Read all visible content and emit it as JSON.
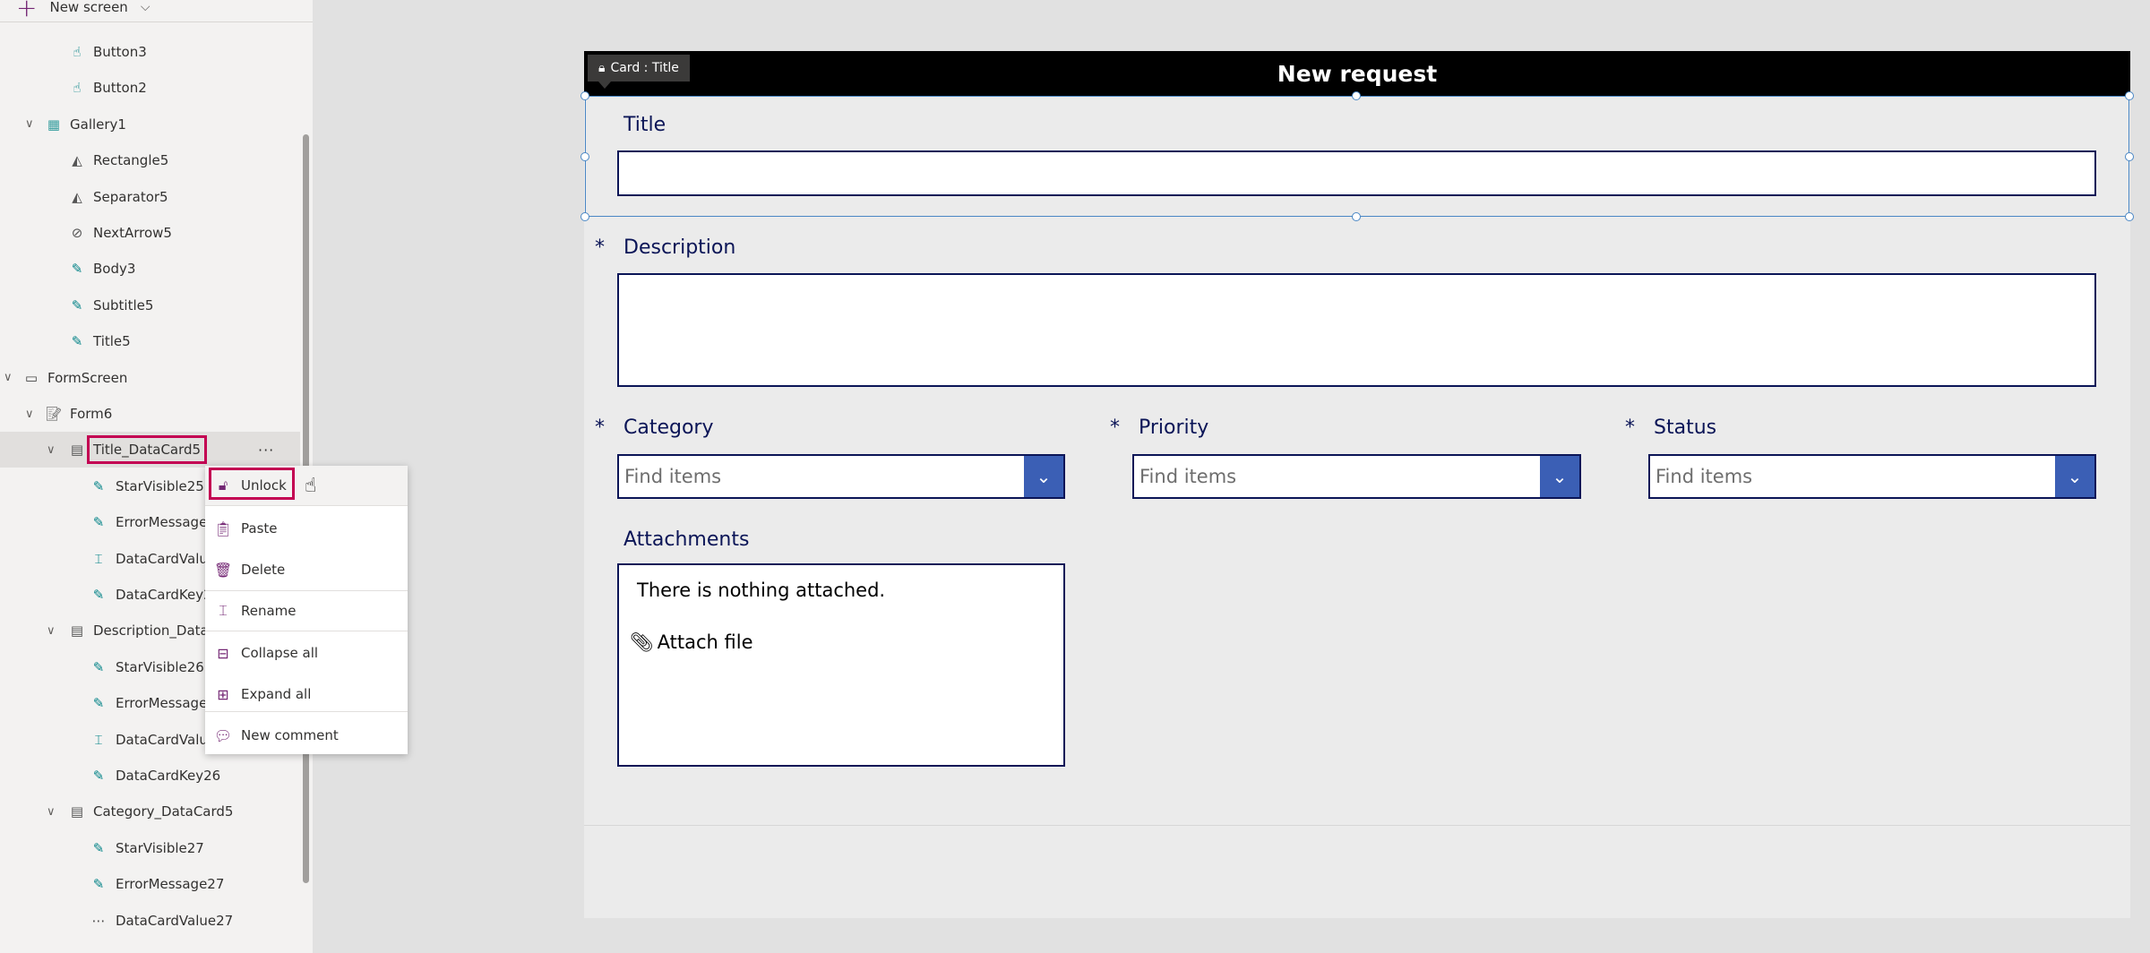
{
  "tree": {
    "new_screen": "New screen",
    "items": [
      {
        "label": "Button3",
        "level": 2,
        "icon": "button-icon"
      },
      {
        "label": "Button2",
        "level": 2,
        "icon": "button-icon"
      },
      {
        "label": "Gallery1",
        "level": 1,
        "icon": "gallery-icon",
        "expanded": true
      },
      {
        "label": "Rectangle5",
        "level": 2,
        "icon": "shape-icon"
      },
      {
        "label": "Separator5",
        "level": 2,
        "icon": "shape-icon"
      },
      {
        "label": "NextArrow5",
        "level": 2,
        "icon": "icons-icon"
      },
      {
        "label": "Body3",
        "level": 2,
        "icon": "label-icon"
      },
      {
        "label": "Subtitle5",
        "level": 2,
        "icon": "label-icon"
      },
      {
        "label": "Title5",
        "level": 2,
        "icon": "label-icon"
      },
      {
        "label": "FormScreen",
        "level": 0,
        "icon": "screen-icon",
        "expanded": true
      },
      {
        "label": "Form6",
        "level": 1,
        "icon": "form-icon",
        "expanded": true
      },
      {
        "label": "Title_DataCard5",
        "level": 2,
        "icon": "card-icon",
        "expanded": true,
        "selected": true
      },
      {
        "label": "StarVisible25",
        "level": 3,
        "icon": "label-icon"
      },
      {
        "label": "ErrorMessage2",
        "level": 3,
        "icon": "label-icon"
      },
      {
        "label": "DataCardValue",
        "level": 3,
        "icon": "textinput-icon"
      },
      {
        "label": "DataCardKey25",
        "level": 3,
        "icon": "label-icon"
      },
      {
        "label": "Description_DataCa",
        "level": 2,
        "icon": "card-icon",
        "expanded": true
      },
      {
        "label": "StarVisible26",
        "level": 3,
        "icon": "label-icon"
      },
      {
        "label": "ErrorMessage2",
        "level": 3,
        "icon": "label-icon"
      },
      {
        "label": "DataCardValue",
        "level": 3,
        "icon": "textinput-icon"
      },
      {
        "label": "DataCardKey26",
        "level": 3,
        "icon": "label-icon"
      },
      {
        "label": "Category_DataCard5",
        "level": 2,
        "icon": "card-icon",
        "expanded": true
      },
      {
        "label": "StarVisible27",
        "level": 3,
        "icon": "label-icon"
      },
      {
        "label": "ErrorMessage27",
        "level": 3,
        "icon": "label-icon"
      },
      {
        "label": "DataCardValue27",
        "level": 3,
        "icon": "combobox-icon"
      }
    ]
  },
  "context_menu": {
    "items": [
      {
        "label": "Unlock",
        "icon": "unlock-icon"
      },
      {
        "label": "Paste",
        "icon": "paste-icon"
      },
      {
        "label": "Delete",
        "icon": "delete-icon"
      },
      {
        "label": "Rename",
        "icon": "rename-icon"
      },
      {
        "label": "Collapse all",
        "icon": "collapse-all-icon"
      },
      {
        "label": "Expand all",
        "icon": "expand-all-icon"
      },
      {
        "label": "New comment",
        "icon": "new-comment-icon"
      }
    ]
  },
  "form": {
    "header": "New request",
    "tooltip": "Card : Title",
    "title_label": "Title",
    "description_label": "Description",
    "required_mark": "*",
    "category_label": "Category",
    "priority_label": "Priority",
    "status_label": "Status",
    "dropdown_placeholder": "Find items",
    "attachments_label": "Attachments",
    "attachments_empty": "There is nothing attached.",
    "attach_file": "Attach file"
  },
  "colors": {
    "accent": "#742774",
    "highlight": "#c30052",
    "label": "#0b1557",
    "dropdown_button": "#3b5fb5"
  }
}
